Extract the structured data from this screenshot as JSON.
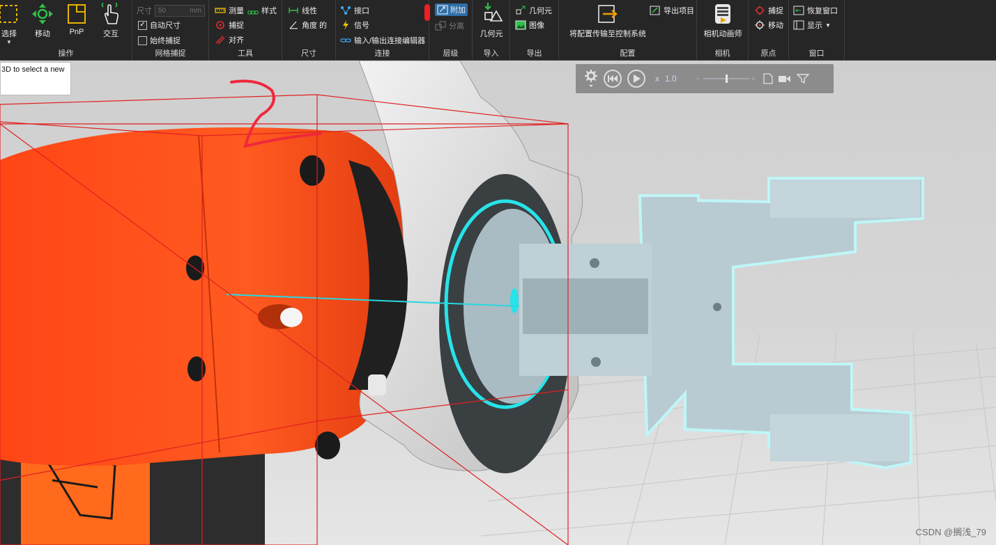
{
  "ribbon": {
    "groups": {
      "operate": {
        "title": "操作",
        "buttons": [
          {
            "label": "选择",
            "icon": "select-box-icon"
          },
          {
            "label": "移动",
            "icon": "move-arrows-icon"
          },
          {
            "label": "PnP",
            "icon": "pnp-icon"
          },
          {
            "label": "交互",
            "icon": "hand-pointer-icon"
          }
        ]
      },
      "grid_snap": {
        "title": "网格捕捉",
        "size_label": "尺寸",
        "size_value": "50",
        "size_unit": "mm",
        "auto_size_label": "自动尺寸",
        "auto_size_checked": true,
        "always_snap_label": "始终捕捉",
        "always_snap_checked": false
      },
      "tools": {
        "title": "工具",
        "items": [
          "测量",
          "样式",
          "捕捉",
          "对齐"
        ]
      },
      "dimension": {
        "title": "尺寸",
        "items": [
          "线性",
          "角度 的"
        ]
      },
      "connect": {
        "title": "连接",
        "items": [
          "接口",
          "信号",
          "输入/输出连接编辑器"
        ]
      },
      "hierarchy": {
        "title": "层级",
        "attach_label": "附加",
        "detach_label": "分离"
      },
      "import": {
        "title": "导入",
        "geometry_label": "几何元"
      },
      "export": {
        "title": "导出",
        "items": [
          "几何元",
          "图像"
        ]
      },
      "config": {
        "title": "配置",
        "transfer_label": "将配置传输至控制系统",
        "export_project_label": "导出项目"
      },
      "camera": {
        "title": "相机",
        "animator_label": "相机动画师"
      },
      "origin": {
        "title": "原点",
        "items": [
          "捕捉",
          "移动"
        ]
      },
      "window": {
        "title": "窗口",
        "restore_label": "恢复窗口",
        "display_label": "显示"
      }
    }
  },
  "viewport": {
    "tooltip_text": "3D to select a new",
    "playback": {
      "speed_label": "x",
      "speed_value": "1.0"
    },
    "watermark": "CSDN @搁浅_79"
  },
  "colors": {
    "ribbon_bg": "#262626",
    "robot_orange": "#ff4a1a",
    "gripper": "#b9cbd2",
    "highlight_cyan": "#27e3ea",
    "bbox_red": "#e02020",
    "floor": "#d9d9d9"
  }
}
